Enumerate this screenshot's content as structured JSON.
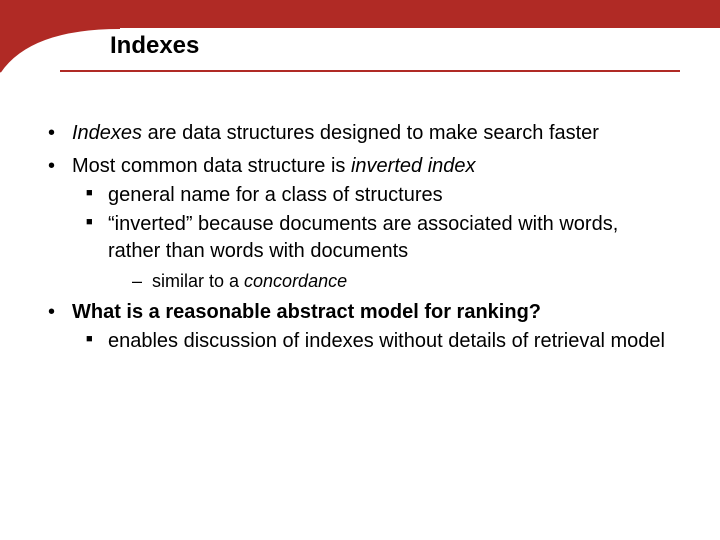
{
  "title": "Indexes",
  "accent_color": "#b02a25",
  "bullets": [
    {
      "parts": [
        "Indexes",
        " are data structures designed to make search faster"
      ]
    },
    {
      "parts": [
        "Most common data structure is ",
        "inverted index"
      ],
      "sub": [
        {
          "text": "general name for a class of structures"
        },
        {
          "text": "“inverted” because documents are associated with words, rather than words with documents",
          "sub": [
            {
              "parts": [
                "similar to a ",
                "concordance"
              ]
            }
          ]
        }
      ]
    },
    {
      "parts": [
        "What is a reasonable abstract model for ranking?"
      ],
      "sub": [
        {
          "text": "enables discussion of indexes without details of retrieval model"
        }
      ]
    }
  ]
}
